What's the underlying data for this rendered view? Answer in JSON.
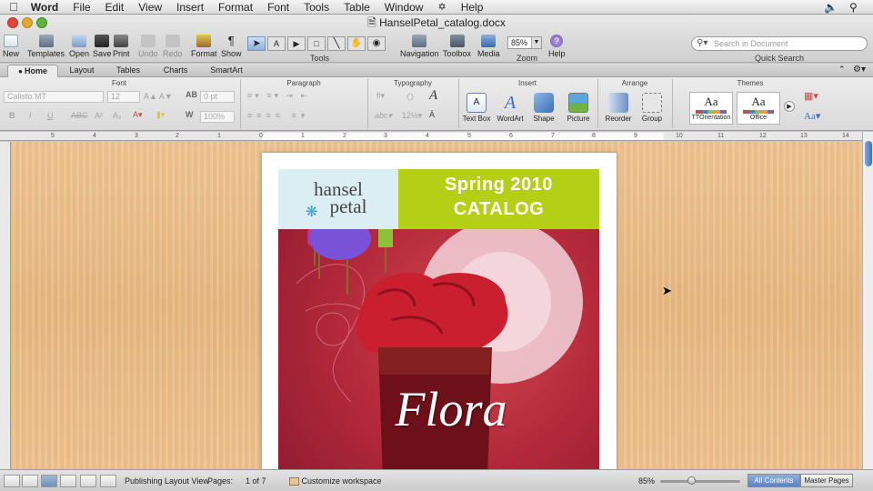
{
  "menubar": {
    "app": "Word",
    "items": [
      "File",
      "Edit",
      "View",
      "Insert",
      "Format",
      "Font",
      "Tools",
      "Table",
      "Window",
      "Help"
    ]
  },
  "window": {
    "title": "HanselPetal_catalog.docx"
  },
  "toolbar": {
    "buttons": [
      "New",
      "Templates",
      "Open",
      "Save",
      "Print",
      "Undo",
      "Redo",
      "Format",
      "Show",
      "Navigation",
      "Toolbox",
      "Media",
      "Zoom",
      "Help"
    ],
    "tools_label": "Tools",
    "zoom_value": "85%",
    "search_placeholder": "Search in Document",
    "quick_search_label": "Quick Search"
  },
  "ribbon": {
    "tabs": [
      "Home",
      "Layout",
      "Tables",
      "Charts",
      "SmartArt"
    ],
    "active_tab": "Home",
    "sections": {
      "font": "Font",
      "paragraph": "Paragraph",
      "typography": "Typography",
      "insert": "Insert",
      "arrange": "Arrange",
      "themes": "Themes"
    },
    "font_name": "Calisto MT",
    "font_size": "12",
    "spacing_value": "0 pt",
    "scale_value": "100%",
    "insert_buttons": [
      "Text Box",
      "WordArt",
      "Shape",
      "Picture"
    ],
    "arrange_buttons": [
      "Reorder",
      "Group"
    ],
    "themes": [
      "TTOrientation",
      "Office"
    ],
    "theme_font_glyph": "Aa"
  },
  "ruler": {
    "numbers": [
      "5",
      "4",
      "3",
      "2",
      "1",
      "0",
      "1",
      "2",
      "3",
      "4",
      "5",
      "6",
      "7",
      "8",
      "9",
      "10",
      "11",
      "12",
      "13",
      "14"
    ]
  },
  "document": {
    "logo_line1": "hansel",
    "logo_line2": "petal",
    "headline_line1": "Spring 2010",
    "headline_line2": "CATALOG",
    "art_title": "Flora"
  },
  "statusbar": {
    "view_name": "Publishing Layout View",
    "pages_label": "Pages:",
    "page_count": "1 of 7",
    "workspace_menu": "Customize workspace",
    "zoom": "85%",
    "all_contents": "All Contents",
    "master_pages": "Master Pages"
  },
  "colors": {
    "green_panel": "#b3cf16",
    "logo_panel": "#dbeef3",
    "art_red": "#b3283a",
    "workspace_wood": "#e8b983"
  }
}
